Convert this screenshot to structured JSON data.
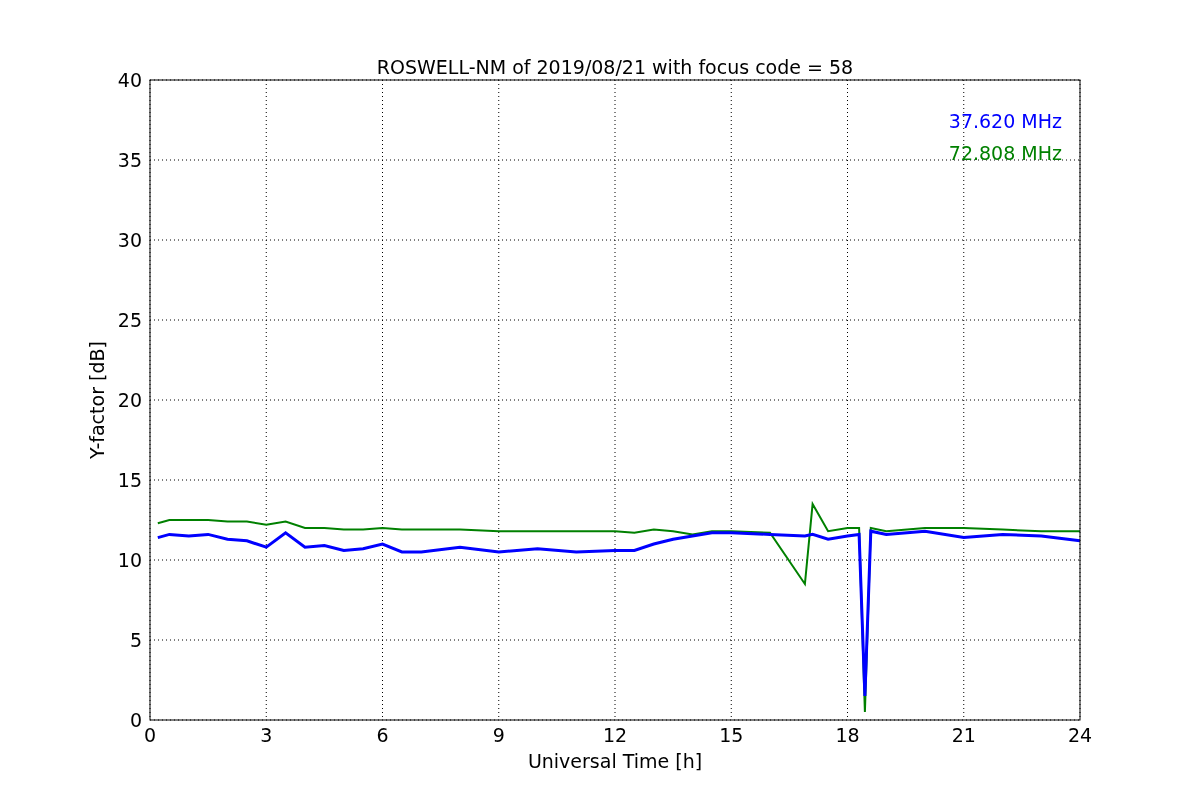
{
  "chart_data": {
    "type": "line",
    "title": "ROSWELL-NM of 2019/08/21 with focus code = 58",
    "xlabel": "Universal Time [h]",
    "ylabel": "Y-factor [dB]",
    "x": [
      0.2,
      0.5,
      1,
      1.5,
      2,
      2.5,
      3,
      3.5,
      4,
      4.5,
      5,
      5.5,
      6,
      6.5,
      7,
      8,
      9,
      10,
      11,
      12,
      12.5,
      13,
      13.5,
      14,
      14.5,
      15,
      16,
      16.9,
      17.1,
      17.5,
      18,
      18.3,
      18.45,
      18.6,
      19,
      20,
      21,
      22,
      23,
      24
    ],
    "series": [
      {
        "name": "37.620 MHz",
        "color": "#0000ff",
        "values": [
          11.4,
          11.6,
          11.5,
          11.6,
          11.3,
          11.2,
          10.8,
          11.7,
          10.8,
          10.9,
          10.6,
          10.7,
          11.0,
          10.5,
          10.5,
          10.8,
          10.5,
          10.7,
          10.5,
          10.6,
          10.6,
          11.0,
          11.3,
          11.5,
          11.7,
          11.7,
          11.6,
          11.5,
          11.6,
          11.3,
          11.5,
          11.6,
          1.5,
          11.8,
          11.6,
          11.8,
          11.4,
          11.6,
          11.5,
          11.2
        ]
      },
      {
        "name": "72.808 MHz",
        "color": "#008000",
        "values": [
          12.3,
          12.5,
          12.5,
          12.5,
          12.4,
          12.4,
          12.2,
          12.4,
          12.0,
          12.0,
          11.9,
          11.9,
          12.0,
          11.9,
          11.9,
          11.9,
          11.8,
          11.8,
          11.8,
          11.8,
          11.7,
          11.9,
          11.8,
          11.6,
          11.8,
          11.8,
          11.7,
          8.5,
          13.5,
          11.8,
          12.0,
          12.0,
          0.5,
          12.0,
          11.8,
          12.0,
          12.0,
          11.9,
          11.8,
          11.8
        ]
      }
    ],
    "xlim": [
      0,
      24
    ],
    "ylim": [
      0,
      40
    ],
    "xticks": [
      0,
      3,
      6,
      9,
      12,
      15,
      18,
      21,
      24
    ],
    "yticks": [
      0,
      5,
      10,
      15,
      20,
      25,
      30,
      35,
      40
    ],
    "grid": true
  }
}
